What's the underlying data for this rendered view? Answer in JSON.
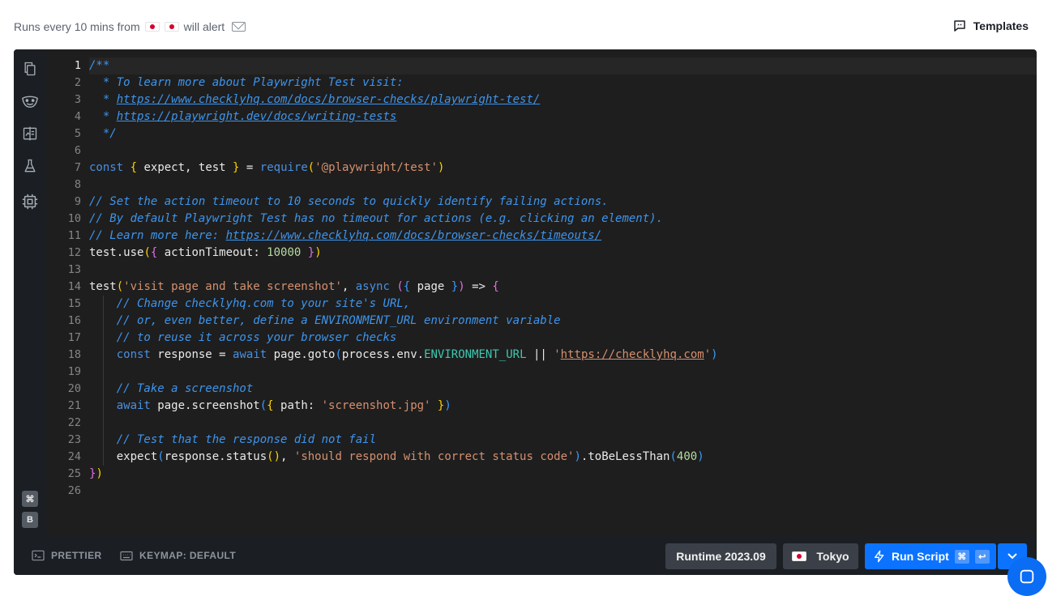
{
  "header": {
    "runs_prefix": "Runs every 10 mins from",
    "runs_suffix": "will alert",
    "flags": [
      "japan-flag",
      "japan-flag"
    ],
    "templates_label": "Templates"
  },
  "sidebar": {
    "icons": [
      "files-icon",
      "playwright-icon",
      "compare-icon",
      "flask-icon",
      "chip-icon"
    ],
    "shortcut_keys": [
      "⌘",
      "B"
    ]
  },
  "editor": {
    "active_line": 1,
    "line_numbers": [
      "1",
      "2",
      "3",
      "4",
      "5",
      "6",
      "7",
      "8",
      "9",
      "10",
      "11",
      "12",
      "13",
      "14",
      "15",
      "16",
      "17",
      "18",
      "19",
      "20",
      "21",
      "22",
      "23",
      "24",
      "25",
      "26"
    ],
    "lines": [
      [
        {
          "t": "/**",
          "c": "cm"
        }
      ],
      [
        {
          "t": "  * To learn more about Playwright Test visit:",
          "c": "cm"
        }
      ],
      [
        {
          "t": "  * ",
          "c": "cm"
        },
        {
          "t": "https://www.checklyhq.com/docs/browser-checks/playwright-test/",
          "c": "lnk"
        }
      ],
      [
        {
          "t": "  * ",
          "c": "cm"
        },
        {
          "t": "https://playwright.dev/docs/writing-tests",
          "c": "lnk"
        }
      ],
      [
        {
          "t": "  */",
          "c": "cm"
        }
      ],
      [],
      [
        {
          "t": "const",
          "c": "kw"
        },
        {
          "t": " "
        },
        {
          "t": "{",
          "c": "b1"
        },
        {
          "t": " expect, test "
        },
        {
          "t": "}",
          "c": "b1"
        },
        {
          "t": " = "
        },
        {
          "t": "require",
          "c": "fn"
        },
        {
          "t": "(",
          "c": "b1"
        },
        {
          "t": "'@playwright/test'",
          "c": "str"
        },
        {
          "t": ")",
          "c": "b1"
        }
      ],
      [],
      [
        {
          "t": "// Set the action timeout to 10 seconds to quickly identify failing actions.",
          "c": "cm"
        }
      ],
      [
        {
          "t": "// By default Playwright Test has no timeout for actions (e.g. clicking an element).",
          "c": "cm"
        }
      ],
      [
        {
          "t": "// Learn more here: ",
          "c": "cm"
        },
        {
          "t": "https://www.checklyhq.com/docs/browser-checks/timeouts/",
          "c": "lnk"
        }
      ],
      [
        {
          "t": "test.use"
        },
        {
          "t": "(",
          "c": "b1"
        },
        {
          "t": "{",
          "c": "b2"
        },
        {
          "t": " actionTimeout: "
        },
        {
          "t": "10000",
          "c": "num"
        },
        {
          "t": " "
        },
        {
          "t": "}",
          "c": "b2"
        },
        {
          "t": ")",
          "c": "b1"
        }
      ],
      [],
      [
        {
          "t": "test"
        },
        {
          "t": "(",
          "c": "b1"
        },
        {
          "t": "'visit page and take screenshot'",
          "c": "str"
        },
        {
          "t": ", "
        },
        {
          "t": "async",
          "c": "kw"
        },
        {
          "t": " "
        },
        {
          "t": "(",
          "c": "b2"
        },
        {
          "t": "{",
          "c": "b3"
        },
        {
          "t": " page "
        },
        {
          "t": "}",
          "c": "b3"
        },
        {
          "t": ")",
          "c": "b2"
        },
        {
          "t": " => "
        },
        {
          "t": "{",
          "c": "b2"
        }
      ],
      [
        {
          "t": "    "
        },
        {
          "t": "// Change checklyhq.com to your site's URL,",
          "c": "cm"
        }
      ],
      [
        {
          "t": "    "
        },
        {
          "t": "// or, even better, define a ENVIRONMENT_URL environment variable",
          "c": "cm"
        }
      ],
      [
        {
          "t": "    "
        },
        {
          "t": "// to reuse it across your browser checks",
          "c": "cm"
        }
      ],
      [
        {
          "t": "    "
        },
        {
          "t": "const",
          "c": "kw"
        },
        {
          "t": " response = "
        },
        {
          "t": "await",
          "c": "kw"
        },
        {
          "t": " page.goto"
        },
        {
          "t": "(",
          "c": "b3"
        },
        {
          "t": "process.env."
        },
        {
          "t": "ENVIRONMENT_URL",
          "c": "prop"
        },
        {
          "t": " || "
        },
        {
          "t": "'",
          "c": "str"
        },
        {
          "t": "https://checklyhq.com",
          "c": "slink"
        },
        {
          "t": "'",
          "c": "str"
        },
        {
          "t": ")",
          "c": "b3"
        }
      ],
      [],
      [
        {
          "t": "    "
        },
        {
          "t": "// Take a screenshot",
          "c": "cm"
        }
      ],
      [
        {
          "t": "    "
        },
        {
          "t": "await",
          "c": "kw"
        },
        {
          "t": " page.screenshot"
        },
        {
          "t": "(",
          "c": "b3"
        },
        {
          "t": "{",
          "c": "b1"
        },
        {
          "t": " path: "
        },
        {
          "t": "'screenshot.jpg'",
          "c": "str"
        },
        {
          "t": " "
        },
        {
          "t": "}",
          "c": "b1"
        },
        {
          "t": ")",
          "c": "b3"
        }
      ],
      [],
      [
        {
          "t": "    "
        },
        {
          "t": "// Test that the response did not fail",
          "c": "cm"
        }
      ],
      [
        {
          "t": "    expect"
        },
        {
          "t": "(",
          "c": "b3"
        },
        {
          "t": "response.status"
        },
        {
          "t": "()",
          "c": "b1"
        },
        {
          "t": ", "
        },
        {
          "t": "'should respond with correct status code'",
          "c": "str"
        },
        {
          "t": ")",
          "c": "b3"
        },
        {
          "t": ".toBeLessThan"
        },
        {
          "t": "(",
          "c": "b3"
        },
        {
          "t": "400",
          "c": "num"
        },
        {
          "t": ")",
          "c": "b3"
        }
      ],
      [
        {
          "t": "}",
          "c": "b2"
        },
        {
          "t": ")",
          "c": "b1"
        }
      ],
      []
    ]
  },
  "footer": {
    "prettier_label": "PRETTIER",
    "keymap_label": "KEYMAP: DEFAULT",
    "runtime_label": "Runtime 2023.09",
    "location_label": "Tokyo",
    "run_label": "Run Script",
    "run_keys": [
      "⌘",
      "↩"
    ]
  },
  "colors": {
    "editor_bg": "#1e1e1e",
    "sidebar_bg": "#1b1f24",
    "accent": "#0b73ff",
    "comment": "#3d95ee",
    "string": "#d6906f"
  }
}
